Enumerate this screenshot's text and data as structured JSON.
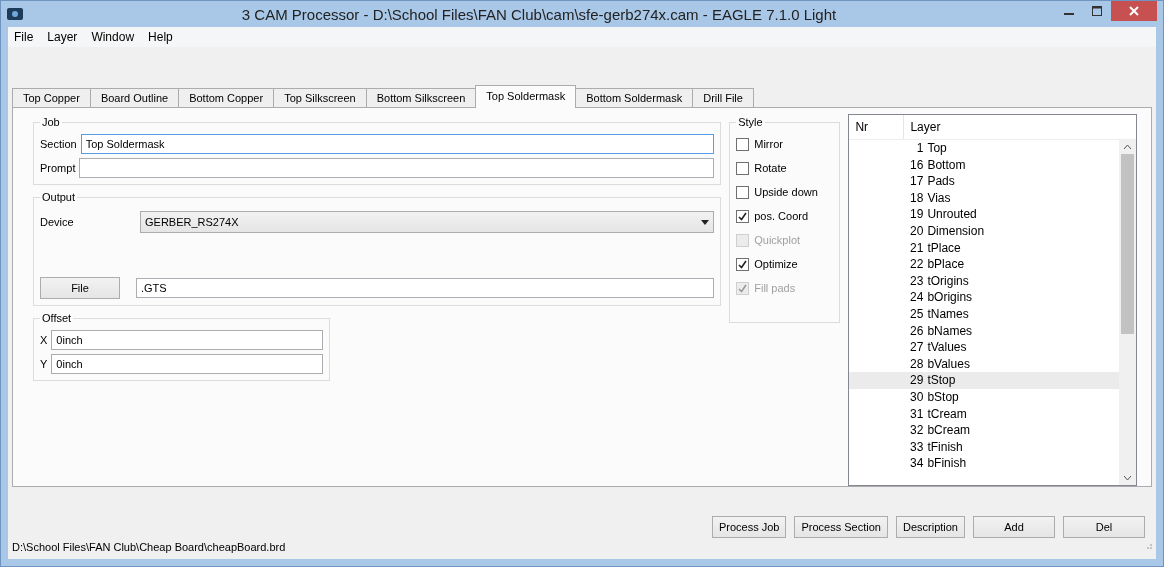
{
  "window": {
    "title": "3 CAM Processor - D:\\School Files\\FAN Club\\cam\\sfe-gerb274x.cam - EAGLE 7.1.0 Light"
  },
  "menu": [
    "File",
    "Layer",
    "Window",
    "Help"
  ],
  "tabs": [
    {
      "label": "Top Copper",
      "selected": false
    },
    {
      "label": "Board Outline",
      "selected": false
    },
    {
      "label": "Bottom Copper",
      "selected": false
    },
    {
      "label": "Top Silkscreen",
      "selected": false
    },
    {
      "label": "Bottom Silkscreen",
      "selected": false
    },
    {
      "label": "Top Soldermask",
      "selected": true
    },
    {
      "label": "Bottom Soldermask",
      "selected": false
    },
    {
      "label": "Drill File",
      "selected": false
    }
  ],
  "job": {
    "title": "Job",
    "section_label": "Section",
    "section_value": "Top Soldermask",
    "prompt_label": "Prompt"
  },
  "output": {
    "title": "Output",
    "device_label": "Device",
    "device_value": "GERBER_RS274X",
    "file_button": "File",
    "file_value": ".GTS"
  },
  "offset": {
    "title": "Offset",
    "x_label": "X",
    "x_value": "0inch",
    "y_label": "Y",
    "y_value": "0inch"
  },
  "style": {
    "title": "Style",
    "options": [
      {
        "label": "Mirror",
        "checked": false,
        "disabled": false
      },
      {
        "label": "Rotate",
        "checked": false,
        "disabled": false
      },
      {
        "label": "Upside down",
        "checked": false,
        "disabled": false
      },
      {
        "label": "pos. Coord",
        "checked": true,
        "disabled": false
      },
      {
        "label": "Quickplot",
        "checked": false,
        "disabled": true
      },
      {
        "label": "Optimize",
        "checked": true,
        "disabled": false
      },
      {
        "label": "Fill pads",
        "checked": true,
        "disabled": true
      }
    ]
  },
  "layers": {
    "columns": [
      "Nr",
      "Layer"
    ],
    "rows": [
      {
        "nr": "1",
        "name": "Top",
        "selected": false
      },
      {
        "nr": "16",
        "name": "Bottom",
        "selected": false
      },
      {
        "nr": "17",
        "name": "Pads",
        "selected": false
      },
      {
        "nr": "18",
        "name": "Vias",
        "selected": false
      },
      {
        "nr": "19",
        "name": "Unrouted",
        "selected": false
      },
      {
        "nr": "20",
        "name": "Dimension",
        "selected": false
      },
      {
        "nr": "21",
        "name": "tPlace",
        "selected": false
      },
      {
        "nr": "22",
        "name": "bPlace",
        "selected": false
      },
      {
        "nr": "23",
        "name": "tOrigins",
        "selected": false
      },
      {
        "nr": "24",
        "name": "bOrigins",
        "selected": false
      },
      {
        "nr": "25",
        "name": "tNames",
        "selected": false
      },
      {
        "nr": "26",
        "name": "bNames",
        "selected": false
      },
      {
        "nr": "27",
        "name": "tValues",
        "selected": false
      },
      {
        "nr": "28",
        "name": "bValues",
        "selected": false
      },
      {
        "nr": "29",
        "name": "tStop",
        "selected": true
      },
      {
        "nr": "30",
        "name": "bStop",
        "selected": false
      },
      {
        "nr": "31",
        "name": "tCream",
        "selected": false
      },
      {
        "nr": "32",
        "name": "bCream",
        "selected": false
      },
      {
        "nr": "33",
        "name": "tFinish",
        "selected": false
      },
      {
        "nr": "34",
        "name": "bFinish",
        "selected": false
      }
    ]
  },
  "buttons": [
    "Process Job",
    "Process Section",
    "Description",
    "Add",
    "Del"
  ],
  "status_bar": "D:\\School Files\\FAN Club\\Cheap Board\\cheapBoard.brd"
}
